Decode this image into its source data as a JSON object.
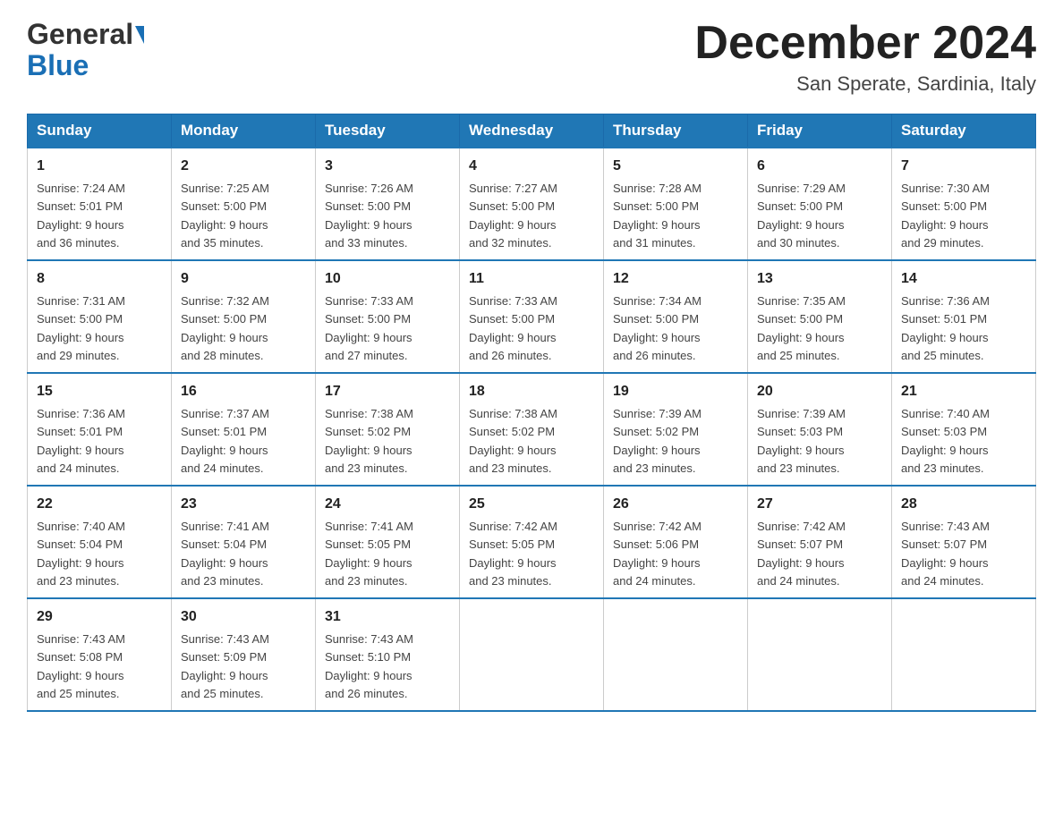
{
  "header": {
    "logo_general": "General",
    "logo_blue": "Blue",
    "month_title": "December 2024",
    "location": "San Sperate, Sardinia, Italy"
  },
  "days_of_week": [
    "Sunday",
    "Monday",
    "Tuesday",
    "Wednesday",
    "Thursday",
    "Friday",
    "Saturday"
  ],
  "weeks": [
    [
      {
        "day": "1",
        "sunrise": "7:24 AM",
        "sunset": "5:01 PM",
        "daylight": "9 hours and 36 minutes."
      },
      {
        "day": "2",
        "sunrise": "7:25 AM",
        "sunset": "5:00 PM",
        "daylight": "9 hours and 35 minutes."
      },
      {
        "day": "3",
        "sunrise": "7:26 AM",
        "sunset": "5:00 PM",
        "daylight": "9 hours and 33 minutes."
      },
      {
        "day": "4",
        "sunrise": "7:27 AM",
        "sunset": "5:00 PM",
        "daylight": "9 hours and 32 minutes."
      },
      {
        "day": "5",
        "sunrise": "7:28 AM",
        "sunset": "5:00 PM",
        "daylight": "9 hours and 31 minutes."
      },
      {
        "day": "6",
        "sunrise": "7:29 AM",
        "sunset": "5:00 PM",
        "daylight": "9 hours and 30 minutes."
      },
      {
        "day": "7",
        "sunrise": "7:30 AM",
        "sunset": "5:00 PM",
        "daylight": "9 hours and 29 minutes."
      }
    ],
    [
      {
        "day": "8",
        "sunrise": "7:31 AM",
        "sunset": "5:00 PM",
        "daylight": "9 hours and 29 minutes."
      },
      {
        "day": "9",
        "sunrise": "7:32 AM",
        "sunset": "5:00 PM",
        "daylight": "9 hours and 28 minutes."
      },
      {
        "day": "10",
        "sunrise": "7:33 AM",
        "sunset": "5:00 PM",
        "daylight": "9 hours and 27 minutes."
      },
      {
        "day": "11",
        "sunrise": "7:33 AM",
        "sunset": "5:00 PM",
        "daylight": "9 hours and 26 minutes."
      },
      {
        "day": "12",
        "sunrise": "7:34 AM",
        "sunset": "5:00 PM",
        "daylight": "9 hours and 26 minutes."
      },
      {
        "day": "13",
        "sunrise": "7:35 AM",
        "sunset": "5:00 PM",
        "daylight": "9 hours and 25 minutes."
      },
      {
        "day": "14",
        "sunrise": "7:36 AM",
        "sunset": "5:01 PM",
        "daylight": "9 hours and 25 minutes."
      }
    ],
    [
      {
        "day": "15",
        "sunrise": "7:36 AM",
        "sunset": "5:01 PM",
        "daylight": "9 hours and 24 minutes."
      },
      {
        "day": "16",
        "sunrise": "7:37 AM",
        "sunset": "5:01 PM",
        "daylight": "9 hours and 24 minutes."
      },
      {
        "day": "17",
        "sunrise": "7:38 AM",
        "sunset": "5:02 PM",
        "daylight": "9 hours and 23 minutes."
      },
      {
        "day": "18",
        "sunrise": "7:38 AM",
        "sunset": "5:02 PM",
        "daylight": "9 hours and 23 minutes."
      },
      {
        "day": "19",
        "sunrise": "7:39 AM",
        "sunset": "5:02 PM",
        "daylight": "9 hours and 23 minutes."
      },
      {
        "day": "20",
        "sunrise": "7:39 AM",
        "sunset": "5:03 PM",
        "daylight": "9 hours and 23 minutes."
      },
      {
        "day": "21",
        "sunrise": "7:40 AM",
        "sunset": "5:03 PM",
        "daylight": "9 hours and 23 minutes."
      }
    ],
    [
      {
        "day": "22",
        "sunrise": "7:40 AM",
        "sunset": "5:04 PM",
        "daylight": "9 hours and 23 minutes."
      },
      {
        "day": "23",
        "sunrise": "7:41 AM",
        "sunset": "5:04 PM",
        "daylight": "9 hours and 23 minutes."
      },
      {
        "day": "24",
        "sunrise": "7:41 AM",
        "sunset": "5:05 PM",
        "daylight": "9 hours and 23 minutes."
      },
      {
        "day": "25",
        "sunrise": "7:42 AM",
        "sunset": "5:05 PM",
        "daylight": "9 hours and 23 minutes."
      },
      {
        "day": "26",
        "sunrise": "7:42 AM",
        "sunset": "5:06 PM",
        "daylight": "9 hours and 24 minutes."
      },
      {
        "day": "27",
        "sunrise": "7:42 AM",
        "sunset": "5:07 PM",
        "daylight": "9 hours and 24 minutes."
      },
      {
        "day": "28",
        "sunrise": "7:43 AM",
        "sunset": "5:07 PM",
        "daylight": "9 hours and 24 minutes."
      }
    ],
    [
      {
        "day": "29",
        "sunrise": "7:43 AM",
        "sunset": "5:08 PM",
        "daylight": "9 hours and 25 minutes."
      },
      {
        "day": "30",
        "sunrise": "7:43 AM",
        "sunset": "5:09 PM",
        "daylight": "9 hours and 25 minutes."
      },
      {
        "day": "31",
        "sunrise": "7:43 AM",
        "sunset": "5:10 PM",
        "daylight": "9 hours and 26 minutes."
      },
      null,
      null,
      null,
      null
    ]
  ],
  "labels": {
    "sunrise": "Sunrise:",
    "sunset": "Sunset:",
    "daylight": "Daylight:"
  }
}
